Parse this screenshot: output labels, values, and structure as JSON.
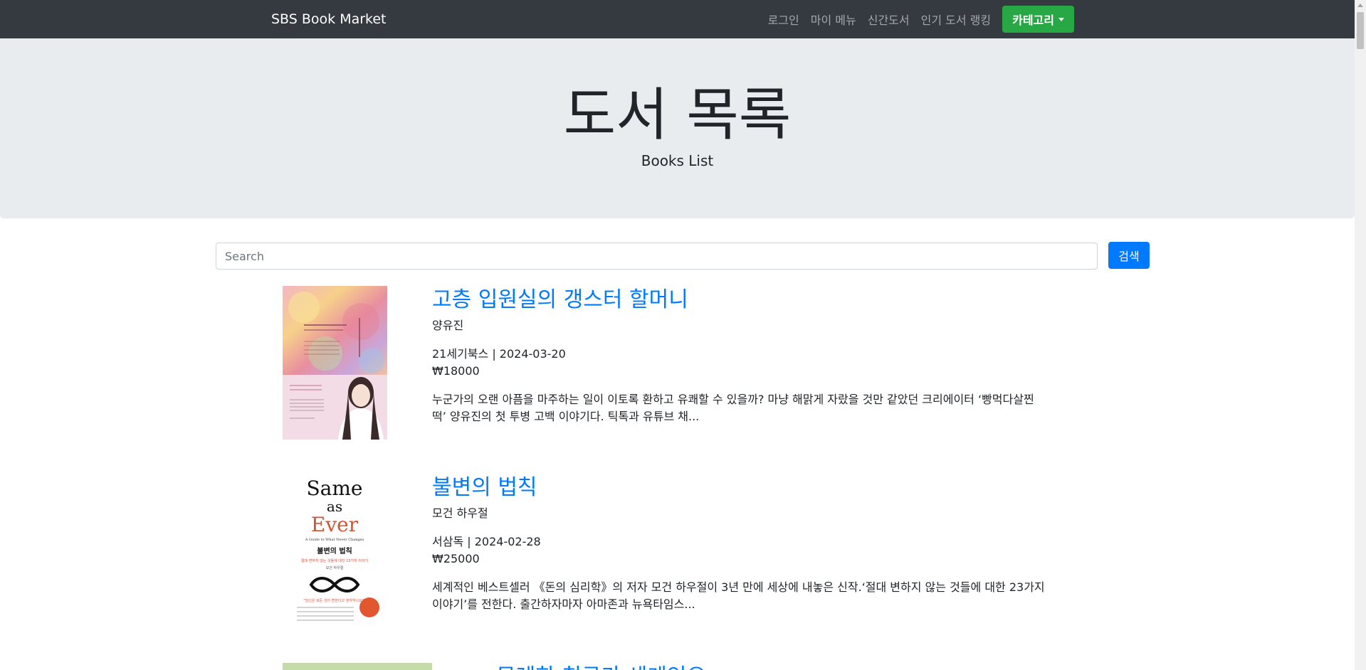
{
  "navbar": {
    "brand": "SBS Book Market",
    "links": [
      "로그인",
      "마이 메뉴",
      "신간도서",
      "인기 도서 랭킹"
    ],
    "dropdown_label": "카테고리"
  },
  "jumbotron": {
    "title": "도서 목록",
    "subtitle": "Books List"
  },
  "search": {
    "placeholder": "Search",
    "value": "",
    "button_label": "검색"
  },
  "books": [
    {
      "title": "고층 입원실의 갱스터 할머니",
      "author": "양유진",
      "publisher_date": "21세기북스 | 2024-03-20",
      "price": "₩18000",
      "description_line1": "누군가의 오랜 아픔을 마주하는 일이 이토록 환하고 유쾌할 수 있을까? 마냥 해맑게 자랐을 것만 같았던 크리에이터 ‘빵먹다살찐",
      "description_line2": "떡’ 양유진의 첫 투병 고백 이야기다. 틱톡과 유튜브 채..."
    },
    {
      "title": "불변의 법칙",
      "author": "모건 하우절",
      "publisher_date": "서삼독 | 2024-02-28",
      "price": "₩25000",
      "description_line1": "세계적인 베스트셀러 《돈의 심리학》의 저자 모건 하우절이 3년 만에 세상에 내놓은 신작.‘절대 변하지 않는 것들에 대한 23가지",
      "description_line2": "이야기’를 전한다. 출간하자마자 아마존과 뉴욕타임스...",
      "cover_text": {
        "title_line1": "Same",
        "title_line2": "as",
        "title_line3": "Ever",
        "subtitle_en": "A Guide to What Never Changes",
        "title_ko": "불변의 법칙",
        "tagline_ko": "절대 변하지 않는 것들에 대한 23가지 이야기",
        "author_ko": "모건 하우절",
        "quote_ko": "\"당신은 모든 것이 변한다고 생각하나요?\""
      }
    }
  ],
  "partial_book": {
    "title": "무례한 친구가 세계인으"
  },
  "colors": {
    "navbar_bg": "#343a40",
    "jumbotron_bg": "#e9ecef",
    "link_blue": "#007bff",
    "dropdown_green": "#28a745"
  }
}
